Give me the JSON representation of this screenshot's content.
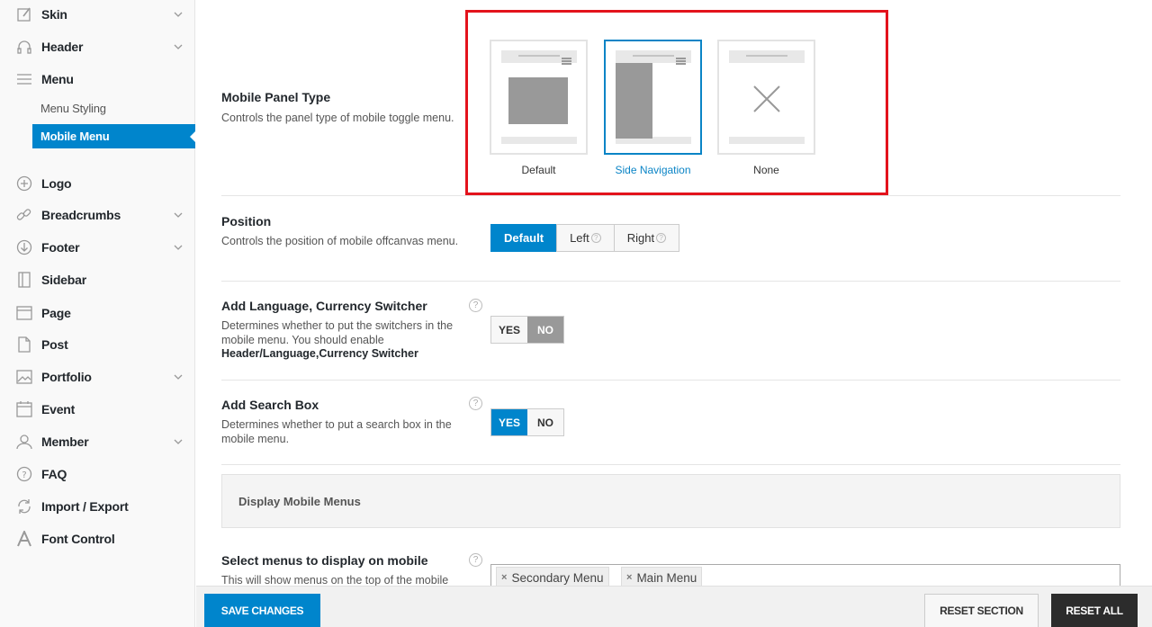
{
  "sidebar": {
    "items": [
      {
        "label": "Skin",
        "icon": "paintbrush-icon"
      },
      {
        "label": "Header",
        "icon": "headphones-icon"
      },
      {
        "label": "Menu",
        "icon": "menu-icon"
      },
      {
        "label": "Logo",
        "icon": "plus-circle-icon"
      },
      {
        "label": "Breadcrumbs",
        "icon": "link-icon"
      },
      {
        "label": "Footer",
        "icon": "arrow-down-circle-icon"
      },
      {
        "label": "Sidebar",
        "icon": "sidebar-icon"
      },
      {
        "label": "Page",
        "icon": "page-icon"
      },
      {
        "label": "Post",
        "icon": "post-icon"
      },
      {
        "label": "Portfolio",
        "icon": "image-icon"
      },
      {
        "label": "Event",
        "icon": "calendar-icon"
      },
      {
        "label": "Member",
        "icon": "user-icon"
      },
      {
        "label": "FAQ",
        "icon": "question-circle-icon"
      },
      {
        "label": "Import / Export",
        "icon": "refresh-icon"
      },
      {
        "label": "Font Control",
        "icon": "font-icon"
      }
    ],
    "submenu": [
      {
        "label": "Menu Styling"
      },
      {
        "label": "Mobile Menu"
      }
    ]
  },
  "options": {
    "panel_type": {
      "title": "Mobile Panel Type",
      "desc": "Controls the panel type of mobile toggle menu.",
      "choices": [
        {
          "label": "Default"
        },
        {
          "label": "Side Navigation"
        },
        {
          "label": "None"
        }
      ],
      "selected": "Side Navigation"
    },
    "position": {
      "title": "Position",
      "desc": "Controls the position of mobile offcanvas menu.",
      "buttons": [
        {
          "label": "Default"
        },
        {
          "label": "Left"
        },
        {
          "label": "Right"
        }
      ],
      "selected": "Default"
    },
    "lang_switcher": {
      "title": "Add Language, Currency Switcher",
      "desc": "Determines whether to put the switchers in the mobile menu. You should enable",
      "desc_bold": "Header/Language,Currency Switcher",
      "yes": "YES",
      "no": "NO",
      "value": "NO"
    },
    "search_box": {
      "title": "Add Search Box",
      "desc": "Determines whether to put a search box in the mobile menu.",
      "yes": "YES",
      "no": "NO",
      "value": "YES"
    },
    "section": {
      "title": "Display Mobile Menus"
    },
    "menus": {
      "title": "Select menus to display on mobile",
      "desc": "This will show menus on the top of the mobile",
      "chips": [
        {
          "label": "Secondary Menu"
        },
        {
          "label": "Main Menu"
        }
      ]
    }
  },
  "footer": {
    "save": "SAVE CHANGES",
    "reset_section": "RESET SECTION",
    "reset_all": "RESET ALL"
  },
  "help_glyph": "?",
  "chip_remove_glyph": "×",
  "colors": {
    "accent": "#0085cc",
    "highlight": "#e3131c"
  }
}
